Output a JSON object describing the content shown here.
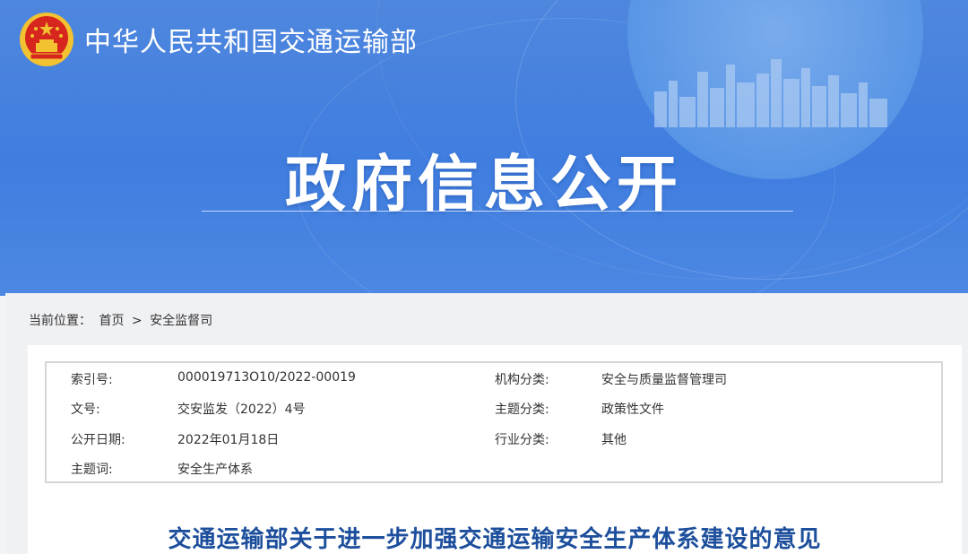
{
  "header": {
    "site_title": "中华人民共和国交通运输部",
    "banner_title": "政府信息公开"
  },
  "breadcrumb": {
    "label": "当前位置：",
    "home": "首页",
    "separator": ">",
    "current": "安全监督司"
  },
  "meta": {
    "rows": [
      {
        "label_left": "索引号:",
        "value_left": "000019713O10/2022-00019",
        "label_right": "机构分类:",
        "value_right": "安全与质量监督管理司"
      },
      {
        "label_left": "文号:",
        "value_left": "交安监发（2022）4号",
        "label_right": "主题分类:",
        "value_right": "政策性文件"
      },
      {
        "label_left": "公开日期:",
        "value_left": "2022年01月18日",
        "label_right": "行业分类:",
        "value_right": "其他"
      },
      {
        "label_left": "主题词:",
        "value_left": "安全生产体系",
        "label_right": "",
        "value_right": ""
      }
    ]
  },
  "document": {
    "title": "交通运输部关于进一步加强交通运输安全生产体系建设的意见"
  },
  "colors": {
    "banner": "#3f7ddf",
    "title_blue": "#1d4f9c",
    "emblem_red": "#d7261e",
    "emblem_gold": "#f2c230"
  }
}
